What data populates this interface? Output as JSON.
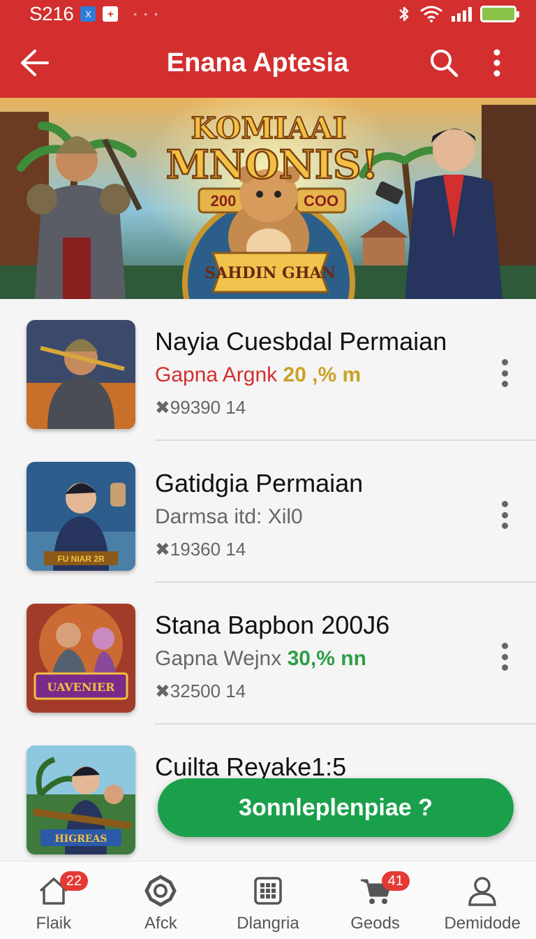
{
  "status_bar": {
    "time": "S216",
    "mini_icon_1": "X",
    "mini_icon_2": "+",
    "dots": "• • •",
    "icons": [
      "bluetooth-icon",
      "wifi-icon",
      "signal-icon",
      "battery-icon"
    ]
  },
  "app_bar": {
    "title": "Enana Aptesia",
    "icons": [
      "back-arrow-icon",
      "search-icon",
      "more-vert-icon"
    ]
  },
  "banner": {
    "headline_1": "KOMIAAI",
    "headline_2": "MNONIS!",
    "left_badge": "200",
    "right_badge": "COO",
    "ribbon": "SAHDIN GHAN"
  },
  "list": {
    "items": [
      {
        "title": "Nayia Cuesbdal Permaian",
        "subtitle_prefix": "Gapna Argnk",
        "subtitle_accent": "20 ,% m",
        "meta": "✖99390  14",
        "prefix_color": "#d32f2f",
        "accent_color": "#c9a227",
        "thumb_palette": "#3b4a6b"
      },
      {
        "title": "Gatidgia Permaian",
        "subtitle_prefix": "Darmsa itd: Xil0",
        "subtitle_accent": "",
        "meta": "✖19360  14",
        "prefix_color": "#666666",
        "accent_color": "#666666",
        "thumb_label": "FU NIAR 2R",
        "thumb_palette": "#2d5d8c"
      },
      {
        "title": "Stana Bapbon 200J6",
        "subtitle_prefix": "Gapna Wejnx",
        "subtitle_accent": "30,% nn",
        "meta": "✖32500  14",
        "prefix_color": "#666666",
        "accent_color": "#2e9e44",
        "thumb_label": "UAVENIER",
        "thumb_palette": "#a33b2a"
      },
      {
        "title": "Cuilta Reyake1:5",
        "subtitle_prefix": "",
        "subtitle_accent": "",
        "meta": "",
        "prefix_color": "#666666",
        "accent_color": "#666666",
        "thumb_label": "HIGREAS",
        "thumb_palette": "#3f7a3c"
      }
    ]
  },
  "fab": {
    "label": "3onnleplenpiae ?"
  },
  "bottom_nav": {
    "items": [
      {
        "label": "Flaik",
        "icon": "home-icon",
        "badge": "22"
      },
      {
        "label": "Afck",
        "icon": "gear-icon",
        "badge": ""
      },
      {
        "label": "Dlangria",
        "icon": "grid-icon",
        "badge": ""
      },
      {
        "label": "Geods",
        "icon": "cart-icon",
        "badge": "41"
      },
      {
        "label": "Demidode",
        "icon": "profile-icon",
        "badge": ""
      }
    ]
  },
  "colors": {
    "primary": "#d32f2f",
    "fab": "#1aa04a",
    "badge": "#e53935"
  }
}
